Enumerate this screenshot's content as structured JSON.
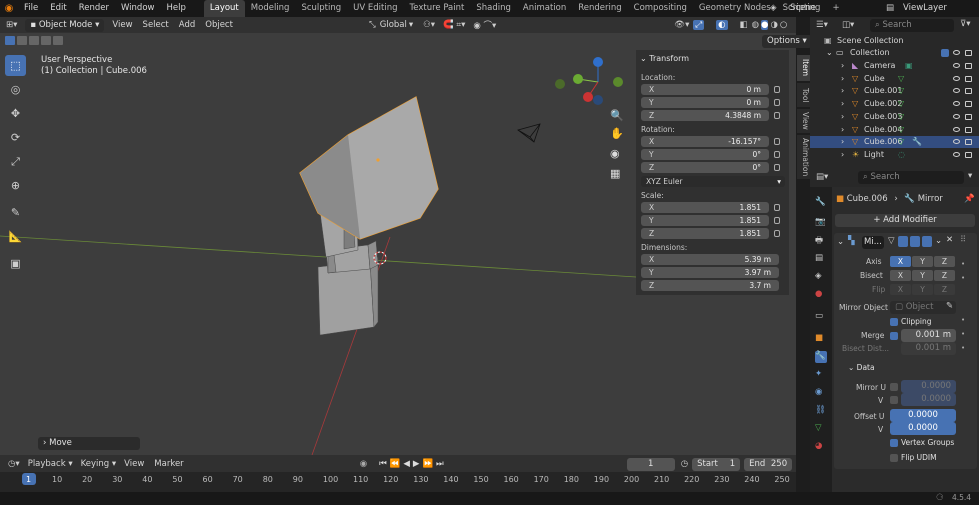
{
  "menu": [
    "File",
    "Edit",
    "Render",
    "Window",
    "Help"
  ],
  "workspaces": [
    "Layout",
    "Modeling",
    "Sculpting",
    "UV Editing",
    "Texture Paint",
    "Shading",
    "Animation",
    "Rendering",
    "Compositing",
    "Geometry Nodes",
    "Scripting",
    "+"
  ],
  "scene": "Scene",
  "viewlayer": "ViewLayer",
  "header": {
    "mode": "Object Mode",
    "view": "View",
    "select": "Select",
    "add": "Add",
    "object": "Object",
    "orientation": "Global",
    "options": "Options"
  },
  "viewport": {
    "perspective": "User Perspective",
    "context": "(1) Collection | Cube.006",
    "last_op": "Move"
  },
  "transform": {
    "title": "Transform",
    "location_label": "Location:",
    "loc": [
      {
        "k": "X",
        "v": "0 m"
      },
      {
        "k": "Y",
        "v": "0 m"
      },
      {
        "k": "Z",
        "v": "4.3848 m"
      }
    ],
    "rotation_label": "Rotation:",
    "rot": [
      {
        "k": "X",
        "v": "-16.157°"
      },
      {
        "k": "Y",
        "v": "0°"
      },
      {
        "k": "Z",
        "v": "0°"
      }
    ],
    "rot_mode": "XYZ Euler",
    "scale_label": "Scale:",
    "scale": [
      {
        "k": "X",
        "v": "1.851"
      },
      {
        "k": "Y",
        "v": "1.851"
      },
      {
        "k": "Z",
        "v": "1.851"
      }
    ],
    "dim_label": "Dimensions:",
    "dim": [
      {
        "k": "X",
        "v": "5.39 m"
      },
      {
        "k": "Y",
        "v": "3.97 m"
      },
      {
        "k": "Z",
        "v": "3.7 m"
      }
    ]
  },
  "side_tabs": [
    "Item",
    "Tool",
    "View",
    "Animation"
  ],
  "outliner": {
    "search": "Search",
    "root": "Scene Collection",
    "collection": "Collection",
    "items": [
      "Camera",
      "Cube",
      "Cube.001",
      "Cube.002",
      "Cube.003",
      "Cube.004",
      "Cube.006",
      "Light"
    ]
  },
  "props": {
    "search": "Search",
    "object": "Cube.006",
    "modifier_crumb": "Mirror",
    "add_modifier": "+ Add Modifier",
    "modifier_name": "Mi...",
    "axis_label": "Axis",
    "bisect_label": "Bisect",
    "flip_label": "Flip",
    "xyz": [
      "X",
      "Y",
      "Z"
    ],
    "mirror_object_label": "Mirror Object",
    "mirror_object_placeholder": "Object",
    "clipping": "Clipping",
    "merge_label": "Merge",
    "merge_value": "0.001 m",
    "bisect_dist_label": "Bisect Dist...",
    "bisect_dist_value": "0.001 m",
    "data_label": "Data",
    "mirror_u": "Mirror U",
    "v": "V",
    "offset_u": "Offset U",
    "mirror_u_val": "0.0000",
    "mirror_v_val": "0.0000",
    "offset_u_val": "0.0000",
    "offset_v_val": "0.0000",
    "vertex_groups": "Vertex Groups",
    "flip_udim": "Flip UDIM"
  },
  "timeline": {
    "playback": "Playback",
    "keying": "Keying",
    "view": "View",
    "marker": "Marker",
    "current": "1",
    "start_label": "Start",
    "start": "1",
    "end_label": "End",
    "end": "250",
    "ticks": [
      "1",
      "10",
      "20",
      "30",
      "40",
      "50",
      "60",
      "70",
      "80",
      "90",
      "100",
      "110",
      "120",
      "130",
      "140",
      "150",
      "160",
      "170",
      "180",
      "190",
      "200",
      "210",
      "220",
      "230",
      "240",
      "250"
    ]
  },
  "status": {
    "version": "4.5.4"
  },
  "colors": {
    "accent": "#4772b3",
    "selection": "#334d80",
    "object_outline": "#f0a030"
  }
}
